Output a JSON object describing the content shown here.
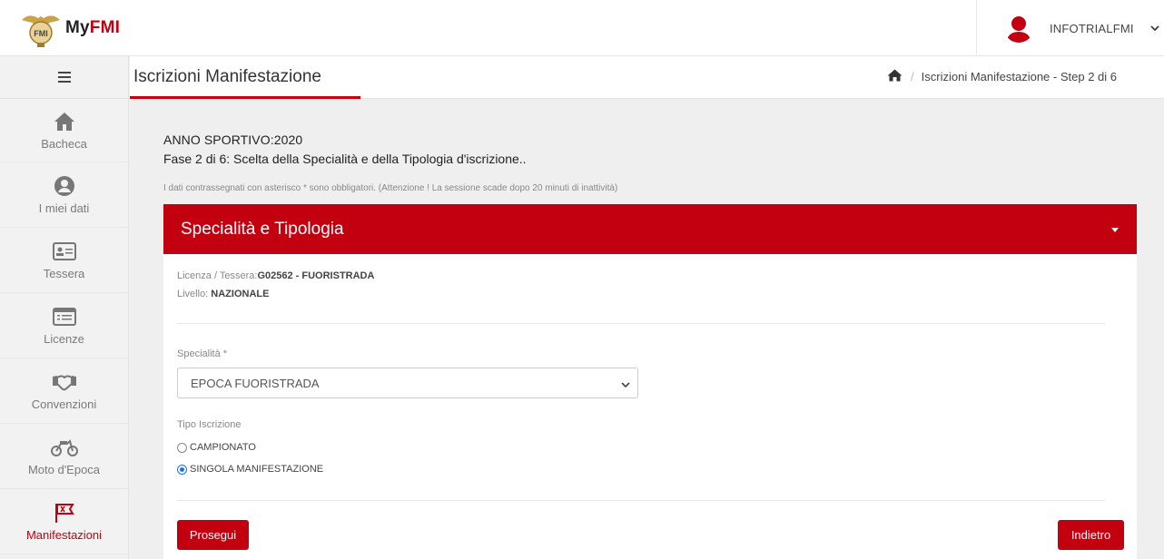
{
  "brand": {
    "my": "My",
    "fmi": "FMI",
    "emblem_text": "FMI"
  },
  "user": {
    "name": "INFOTRIALFMI"
  },
  "sidebar": {
    "items": [
      {
        "label": "Bacheca",
        "icon": "home-icon"
      },
      {
        "label": "I miei dati",
        "icon": "user-circle-icon"
      },
      {
        "label": "Tessera",
        "icon": "id-card-icon"
      },
      {
        "label": "Licenze",
        "icon": "list-card-icon"
      },
      {
        "label": "Convenzioni",
        "icon": "handshake-icon"
      },
      {
        "label": "Moto d'Epoca",
        "icon": "motorcycle-icon"
      },
      {
        "label": "Manifestazioni",
        "icon": "flags-icon"
      }
    ]
  },
  "header": {
    "title": "Iscrizioni Manifestazione",
    "breadcrumb": "Iscrizioni Manifestazione - Step 2 di 6"
  },
  "content": {
    "anno": "ANNO SPORTIVO:2020",
    "fase": "Fase 2 di 6: Scelta della Specialità e della Tipologia d'iscrizione..",
    "note": "I dati contrassegnati con asterisco * sono obbligatori. (Attenzione ! La sessione scade dopo 20 minuti di inattività)"
  },
  "panel": {
    "title": "Specialità e Tipologia",
    "licenza_label": "Licenza / Tessera:",
    "licenza_value": "G02562 - FUORISTRADA",
    "livello_label": "Livello: ",
    "livello_value": "NAZIONALE",
    "specialita_label": "Specialità *",
    "specialita_value": "EPOCA FUORISTRADA",
    "tipo_label": "Tipo Iscrizione",
    "options": [
      {
        "label": "CAMPIONATO",
        "checked": false
      },
      {
        "label": "SINGOLA MANIFESTAZIONE",
        "checked": true
      }
    ]
  },
  "buttons": {
    "prosegui": "Prosegui",
    "indietro": "Indietro"
  },
  "colors": {
    "accent": "#c30010",
    "radio": "#1a73e8"
  }
}
